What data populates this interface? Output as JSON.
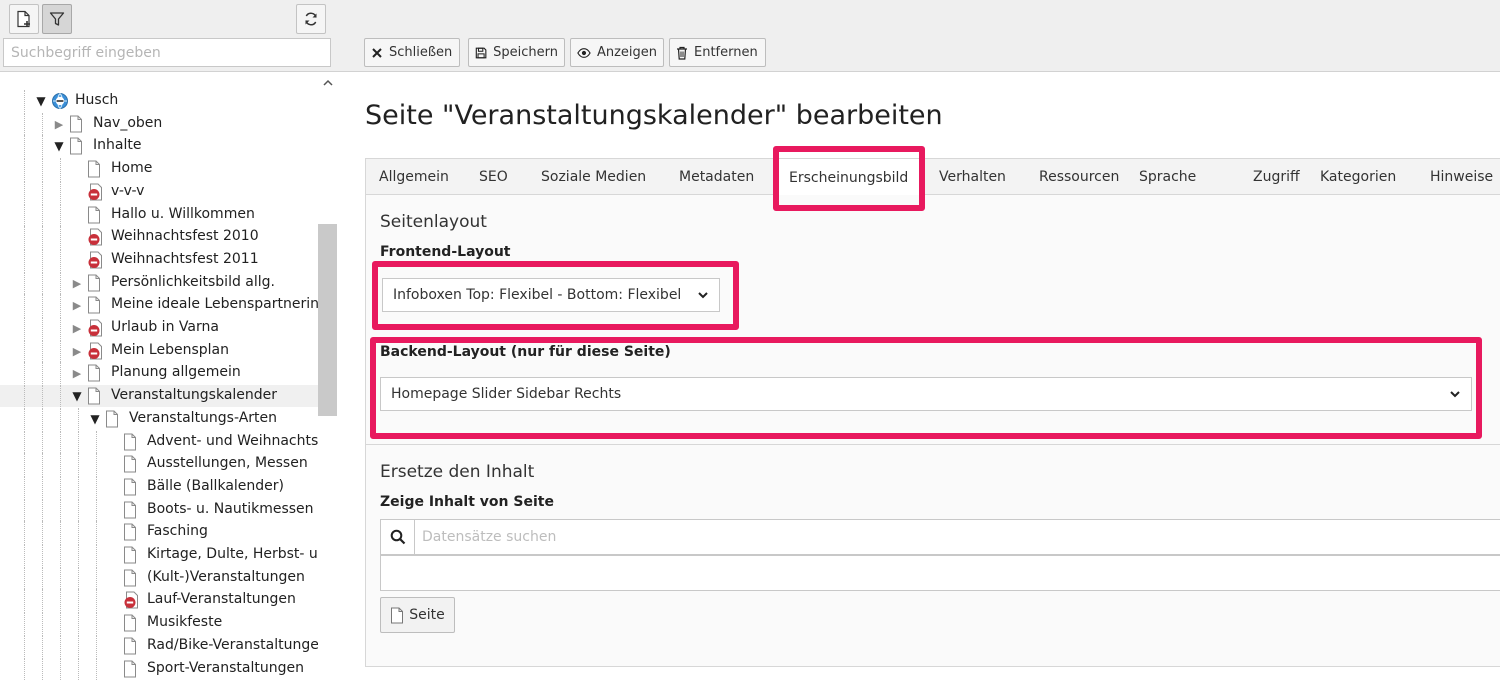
{
  "tree_panel": {
    "search_placeholder": "Suchbegriff eingeben",
    "nodes": [
      {
        "label": "Husch",
        "type": "root",
        "toggle": "open"
      },
      {
        "label": "Nav_oben",
        "type": "page",
        "toggle": "closed"
      },
      {
        "label": "Inhalte",
        "type": "page",
        "toggle": "open"
      },
      {
        "label": "Home",
        "type": "page",
        "toggle": "none"
      },
      {
        "label": "v-v-v",
        "type": "hidden",
        "toggle": "none"
      },
      {
        "label": "Hallo u. Willkommen",
        "type": "page",
        "toggle": "none"
      },
      {
        "label": "Weihnachtsfest 2010",
        "type": "hidden",
        "toggle": "none"
      },
      {
        "label": "Weihnachtsfest 2011",
        "type": "hidden",
        "toggle": "none"
      },
      {
        "label": "Persönlichkeitsbild allg.",
        "type": "page",
        "toggle": "closed"
      },
      {
        "label": "Meine ideale Lebenspartnerin",
        "type": "page",
        "toggle": "closed"
      },
      {
        "label": "Urlaub in Varna",
        "type": "hidden",
        "toggle": "closed"
      },
      {
        "label": "Mein Lebensplan",
        "type": "hidden",
        "toggle": "closed"
      },
      {
        "label": "Planung allgemein",
        "type": "page",
        "toggle": "closed"
      },
      {
        "label": "Veranstaltungskalender",
        "type": "page",
        "toggle": "open"
      },
      {
        "label": "Veranstaltungs-Arten",
        "type": "page",
        "toggle": "open"
      },
      {
        "label": "Advent- und Weihnachtsmärkte",
        "type": "page",
        "toggle": "none"
      },
      {
        "label": "Ausstellungen, Messen",
        "type": "page",
        "toggle": "none"
      },
      {
        "label": "Bälle (Ballkalender)",
        "type": "page",
        "toggle": "none"
      },
      {
        "label": "Boots- u. Nautikmessen",
        "type": "page",
        "toggle": "none"
      },
      {
        "label": "Fasching",
        "type": "page",
        "toggle": "none"
      },
      {
        "label": "Kirtage, Dulte, Herbst- und",
        "type": "page",
        "toggle": "none"
      },
      {
        "label": "(Kult-)Veranstaltungen",
        "type": "page",
        "toggle": "none"
      },
      {
        "label": "Lauf-Veranstaltungen",
        "type": "hidden",
        "toggle": "none"
      },
      {
        "label": "Musikfeste",
        "type": "page",
        "toggle": "none"
      },
      {
        "label": "Rad/Bike-Veranstaltungen",
        "type": "page",
        "toggle": "none"
      },
      {
        "label": "Sport-Veranstaltungen",
        "type": "page",
        "toggle": "none"
      }
    ]
  },
  "toolbar": {
    "close_label": "Schließen",
    "save_label": "Speichern",
    "view_label": "Anzeigen",
    "delete_label": "Entfernen"
  },
  "page_title": "Seite \"Veranstaltungskalender\" bearbeiten",
  "tabs": [
    "Allgemein",
    "SEO",
    "Soziale Medien",
    "Metadaten",
    "Erscheinungsbild",
    "Verhalten",
    "Ressourcen",
    "Sprache",
    "Zugriff",
    "Kategorien",
    "Hinweise"
  ],
  "active_tab": "Erscheinungsbild",
  "form": {
    "section_layout": "Seitenlayout",
    "frontend_label": "Frontend-Layout",
    "frontend_value": "Infoboxen Top: Flexibel - Bottom: Flexibel",
    "backend_label": "Backend-Layout (nur für diese Seite)",
    "backend_value": "Homepage Slider Sidebar Rechts",
    "section_replace": "Ersetze den Inhalt",
    "content_label": "Zeige Inhalt von Seite",
    "search_placeholder": "Datensätze suchen",
    "page_button": "Seite"
  },
  "colors": {
    "highlight": "#e8195e",
    "hidden_badge": "#c8303a",
    "root_globe": "#3a8fd8"
  }
}
